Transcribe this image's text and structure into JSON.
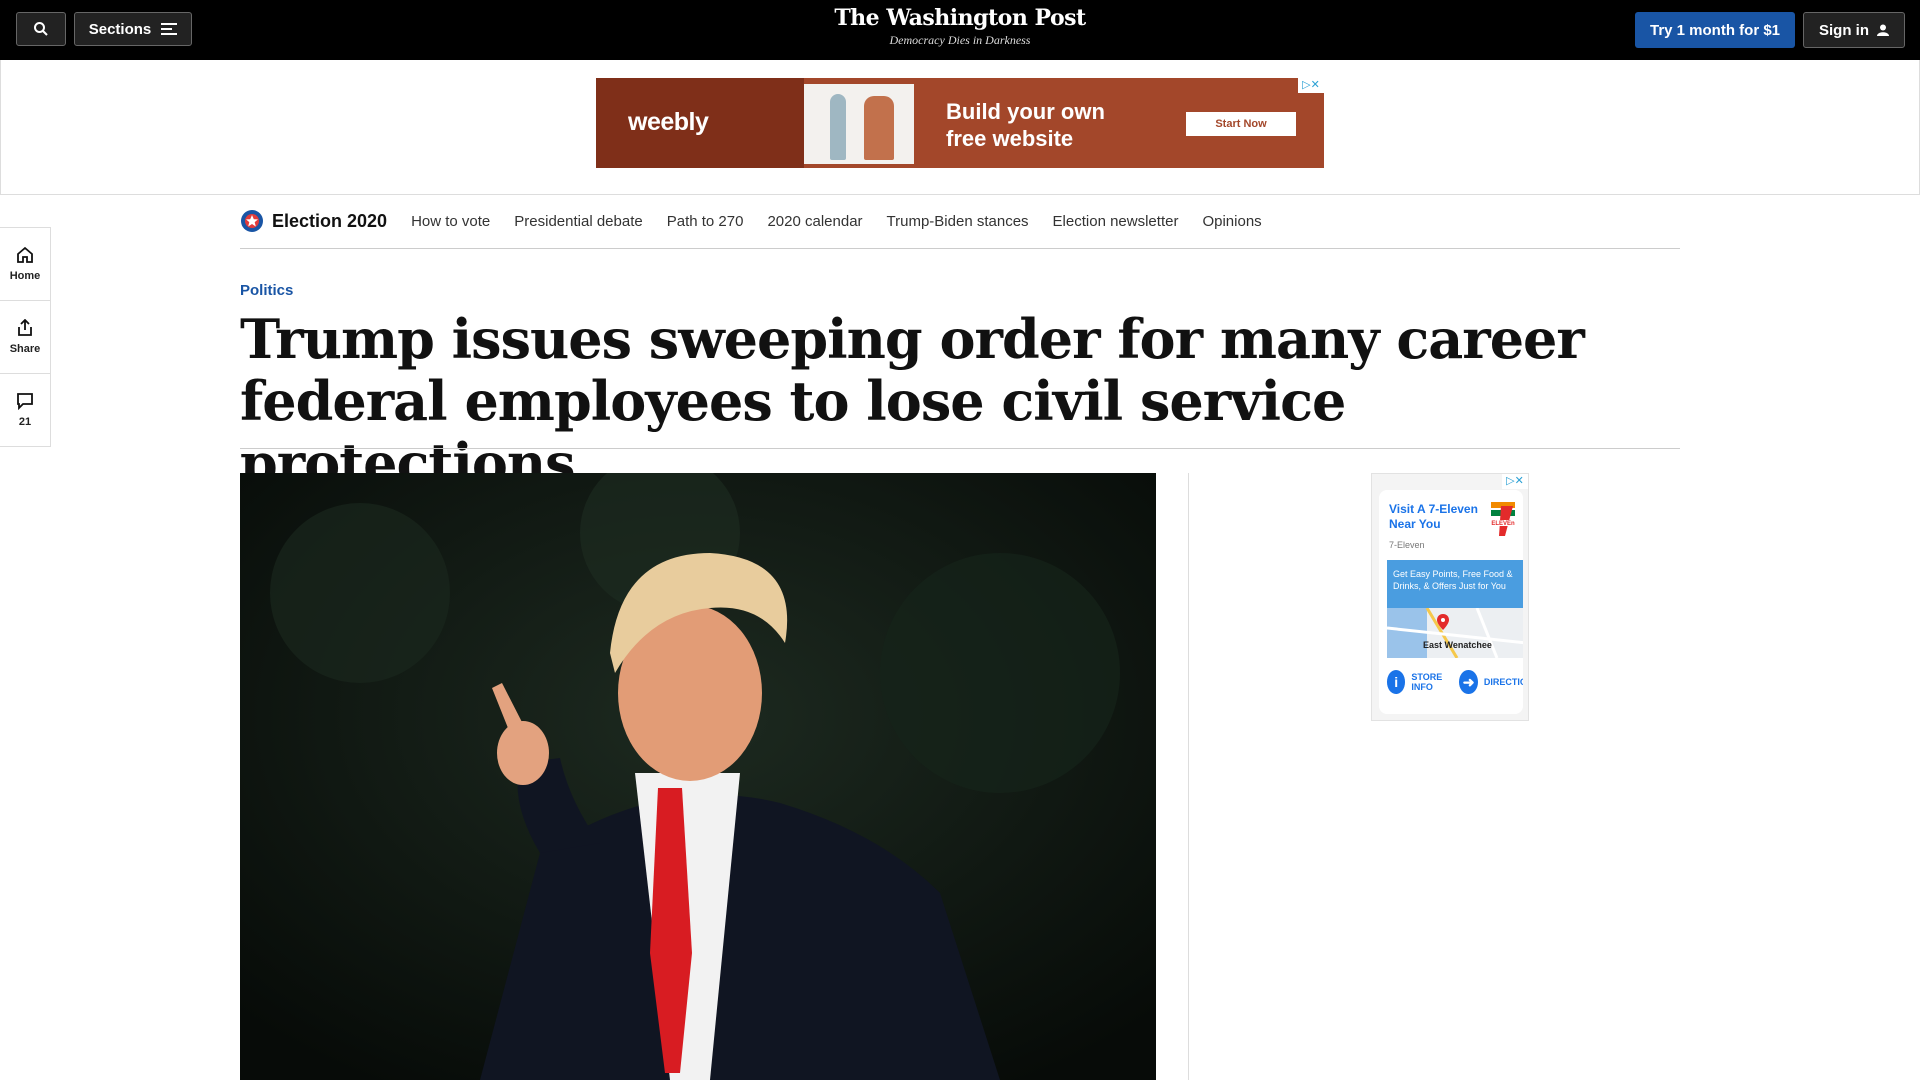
{
  "header": {
    "sections_label": "Sections",
    "logo_title": "The Washington Post",
    "logo_tagline": "Democracy Dies in Darkness",
    "subscribe_label": "Try 1 month for $1",
    "signin_label": "Sign in"
  },
  "top_ad": {
    "brand": "weebly",
    "headline_line1": "Build your own",
    "headline_line2": "free website",
    "cta": "Start Now"
  },
  "election_nav": {
    "title": "Election 2020",
    "links": [
      "How to vote",
      "Presidential debate",
      "Path to 270",
      "2020 calendar",
      "Trump-Biden stances",
      "Election newsletter",
      "Opinions"
    ]
  },
  "rail": {
    "home": "Home",
    "share": "Share",
    "comments_count": "21"
  },
  "article": {
    "kicker": "Politics",
    "headline": "Trump issues sweeping order for many career federal employees to lose civil service protections"
  },
  "side_ad": {
    "title": "Visit A 7-Eleven Near You",
    "advertiser": "7-Eleven",
    "promo": "Get Easy Points, Free Food & Drinks, & Offers Just for You",
    "map_label": "East Wenatchee",
    "store_info": "STORE INFO",
    "directions": "DIRECTIONS"
  },
  "colors": {
    "brand_blue": "#1955a5",
    "ad_bg": "#a3472a"
  }
}
